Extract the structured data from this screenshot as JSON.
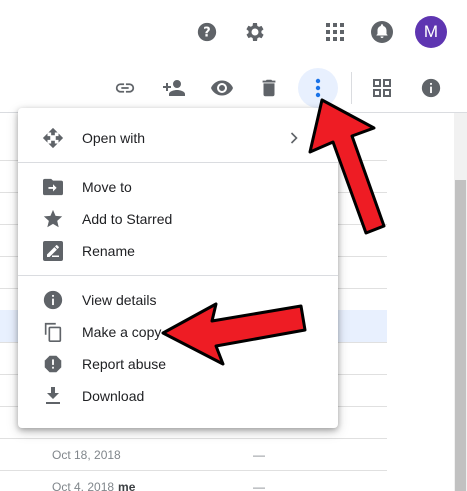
{
  "header": {
    "icons": [
      "help-icon",
      "settings-icon",
      "apps-icon",
      "notifications-icon"
    ],
    "avatar_letter": "M",
    "avatar_color": "#5e35b1"
  },
  "toolbar": {
    "icons": [
      "link-icon",
      "add-person-icon",
      "preview-icon",
      "trash-icon",
      "more-vert-icon",
      "grid-view-icon",
      "info-icon"
    ],
    "more_active_bg": "#e8f0fe"
  },
  "menu": {
    "items": [
      {
        "label": "Open with",
        "icon": "open-with-icon",
        "submenu": true
      },
      {
        "label": "Move to",
        "icon": "move-to-icon"
      },
      {
        "label": "Add to Starred",
        "icon": "star-icon"
      },
      {
        "label": "Rename",
        "icon": "rename-icon"
      },
      {
        "label": "View details",
        "icon": "info-icon"
      },
      {
        "label": "Make a copy",
        "icon": "copy-icon"
      },
      {
        "label": "Report abuse",
        "icon": "report-icon"
      },
      {
        "label": "Download",
        "icon": "download-icon"
      }
    ]
  },
  "file_list": {
    "rows": [
      {
        "date": "Oct 18, 2018",
        "owner": "",
        "size": "—"
      },
      {
        "date": "Oct 4, 2018",
        "owner": "me",
        "size": "—"
      }
    ]
  },
  "annotations": {
    "arrow_color": "#ee1c24",
    "arrow_outline": "#000000"
  }
}
